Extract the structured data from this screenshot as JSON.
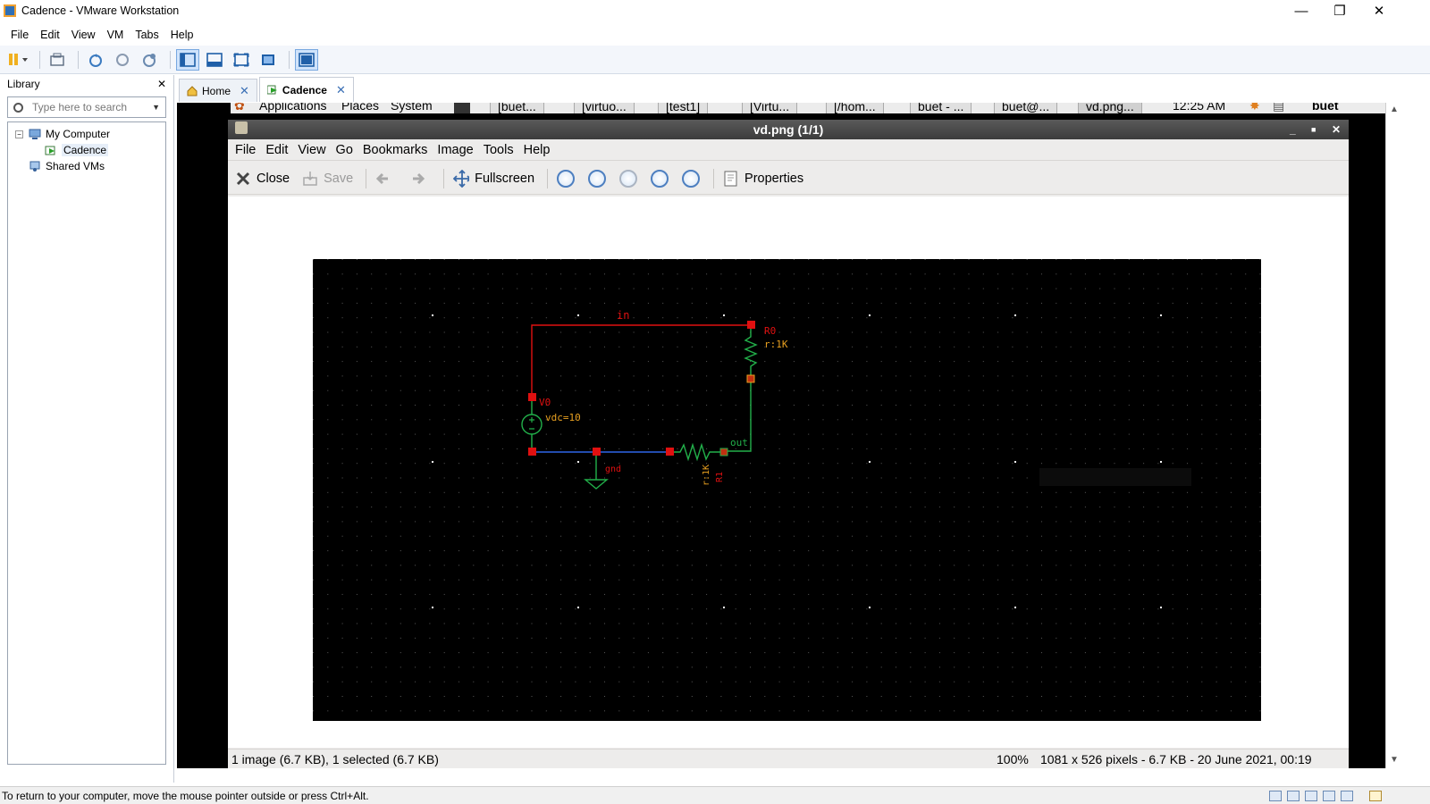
{
  "window": {
    "title": "Cadence - VMware Workstation",
    "minimize": "—",
    "restore": "❐",
    "close": "✕"
  },
  "menu": [
    "File",
    "Edit",
    "View",
    "VM",
    "Tabs",
    "Help"
  ],
  "library": {
    "heading": "Library",
    "close": "✕",
    "search_placeholder": "Type here to search",
    "tree": {
      "root": "My Computer",
      "vm": "Cadence",
      "shared": "Shared VMs"
    }
  },
  "tabs": [
    {
      "label": "Home",
      "close": "✕"
    },
    {
      "label": "Cadence",
      "close": "✕"
    }
  ],
  "gnome_panel": {
    "applications": "Applications",
    "places": "Places",
    "system": "System",
    "tasks": [
      "[buet...",
      "[virtuo...",
      "[test1]",
      "[Virtu...",
      "[/hom...",
      "buet - ...",
      "buet@...",
      "vd.png..."
    ],
    "clock": "12:25 AM",
    "user": "buet"
  },
  "viewer": {
    "title": "vd.png  (1/1)",
    "menu": [
      "File",
      "Edit",
      "View",
      "Go",
      "Bookmarks",
      "Image",
      "Tools",
      "Help"
    ],
    "toolbar": {
      "close": "Close",
      "save": "Save",
      "fullscreen": "Fullscreen",
      "properties": "Properties"
    },
    "status_left": "1 image (6.7 KB), 1 selected (6.7 KB)",
    "status_zoom": "100%",
    "status_info": "1081 x 526 pixels - 6.7 KB - 20 June 2021, 00:19"
  },
  "schematic": {
    "net_in": "in",
    "net_out": "out",
    "gnd": "gnd",
    "r0_name": "R0",
    "r0_value": "r:1K",
    "v0_name": "V0",
    "v0_value": "vdc=10",
    "r1_name": "R1",
    "r1_value": "r:1K"
  },
  "vm_status": "To return to your computer, move the mouse pointer outside or press Ctrl+Alt.",
  "colors": {
    "wire_red": "#e01010",
    "wire_blue": "#2f66e8",
    "wire_green": "#22b04a",
    "label_orange": "#e8a020",
    "label_red": "#e01010"
  }
}
